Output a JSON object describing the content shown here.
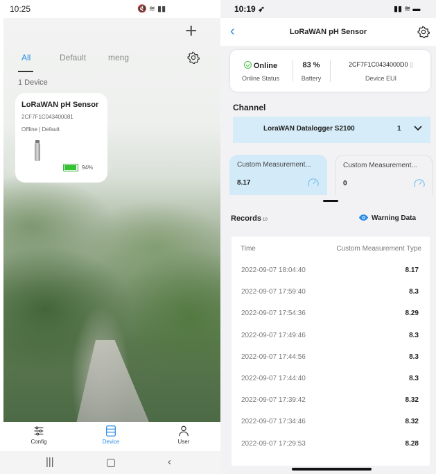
{
  "left": {
    "status": {
      "time": "10:25"
    },
    "tabs": [
      {
        "label": "All"
      },
      {
        "label": "Default"
      },
      {
        "label": "meng"
      }
    ],
    "device_count": "1 Device",
    "device_card": {
      "name": "LoRaWAN pH Sensor",
      "eui": "2CF7F1C043400081",
      "status": "Offline | Default",
      "battery_pct": "94%",
      "battery_level": 0.94
    },
    "nav": [
      {
        "label": "Config"
      },
      {
        "label": "Device"
      },
      {
        "label": "User"
      }
    ],
    "colors": {
      "accent": "#2a8be6",
      "battery": "#33c233"
    }
  },
  "right": {
    "status": {
      "time": "10:19"
    },
    "header": {
      "title": "LoRaWAN pH Sensor"
    },
    "info": {
      "online_value": "Online",
      "online_label": "Online Status",
      "battery_value": "83 %",
      "battery_label": "Battery",
      "eui_value": "2CF7F1C0434000D0",
      "eui_label": "Device EUI"
    },
    "channel": {
      "heading": "Channel",
      "name": "LoraWAN Datalogger S2100",
      "number": "1"
    },
    "measurements": [
      {
        "title": "Custom Measurement...",
        "value": "8.17"
      },
      {
        "title": "Custom Measurement...",
        "value": "0"
      }
    ],
    "records": {
      "title": "Records",
      "count": "10",
      "warning_label": "Warning Data",
      "col_time": "Time",
      "col_type": "Custom Measurement Type",
      "rows": [
        {
          "time": "2022-09-07 18:04:40",
          "value": "8.17"
        },
        {
          "time": "2022-09-07 17:59:40",
          "value": "8.3"
        },
        {
          "time": "2022-09-07 17:54:36",
          "value": "8.29"
        },
        {
          "time": "2022-09-07 17:49:46",
          "value": "8.3"
        },
        {
          "time": "2022-09-07 17:44:56",
          "value": "8.3"
        },
        {
          "time": "2022-09-07 17:44:40",
          "value": "8.3"
        },
        {
          "time": "2022-09-07 17:39:42",
          "value": "8.32"
        },
        {
          "time": "2022-09-07 17:34:46",
          "value": "8.32"
        },
        {
          "time": "2022-09-07 17:29:53",
          "value": "8.28"
        }
      ]
    },
    "colors": {
      "accent": "#2a8be6",
      "channel_bg": "#d6ecf8",
      "online": "#48c048"
    }
  }
}
